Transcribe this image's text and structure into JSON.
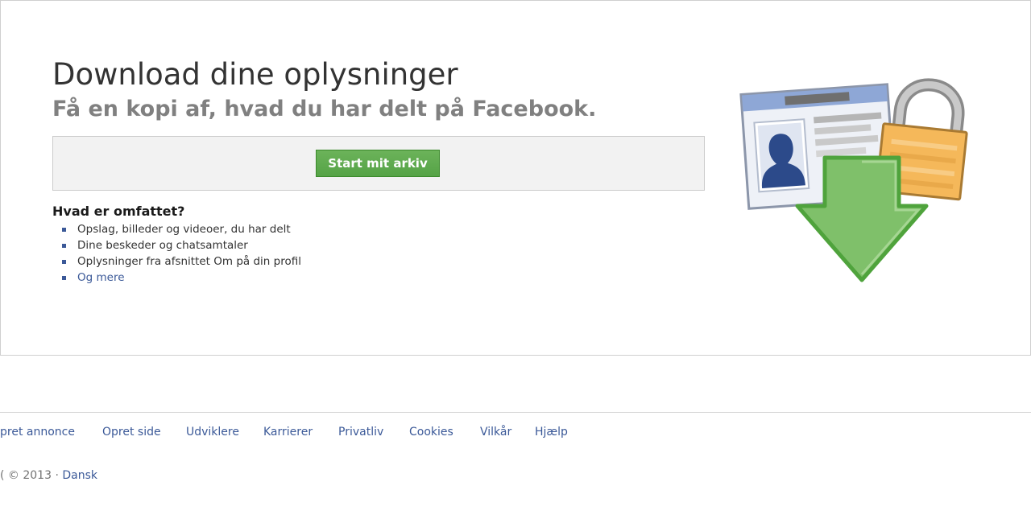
{
  "main": {
    "title": "Download dine oplysninger",
    "subtitle": "Få en kopi af, hvad du har delt på Facebook.",
    "start_button_label": "Start mit arkiv",
    "included_heading": "Hvad er omfattet?",
    "included_items": [
      "Opslag, billeder og videoer, du har delt",
      "Dine beskeder og chatsamtaler",
      "Oplysninger fra afsnittet Om på din profil"
    ],
    "more_link": "Og mere"
  },
  "illustration": {
    "icons": [
      "profile-card-icon",
      "padlock-icon",
      "download-arrow-icon"
    ],
    "colors": {
      "arrow": "#7fc06a",
      "arrow_border": "#4fa33c",
      "lock": "#f5b85a",
      "card_header": "#8ea7d6",
      "silhouette": "#2c4a8a"
    }
  },
  "footer": {
    "links": [
      "pret annonce",
      "Opret side",
      "Udviklere",
      "Karrierer",
      "Privatliv",
      "Cookies",
      "Vilkår",
      "Hjælp"
    ],
    "copyright": "( © 2013 ·",
    "language_link": "Dansk"
  },
  "colors": {
    "link": "#3b5998",
    "button_green": "#5ba84a",
    "panel_border": "#cfcfcf",
    "action_box_bg": "#f2f2f2"
  }
}
